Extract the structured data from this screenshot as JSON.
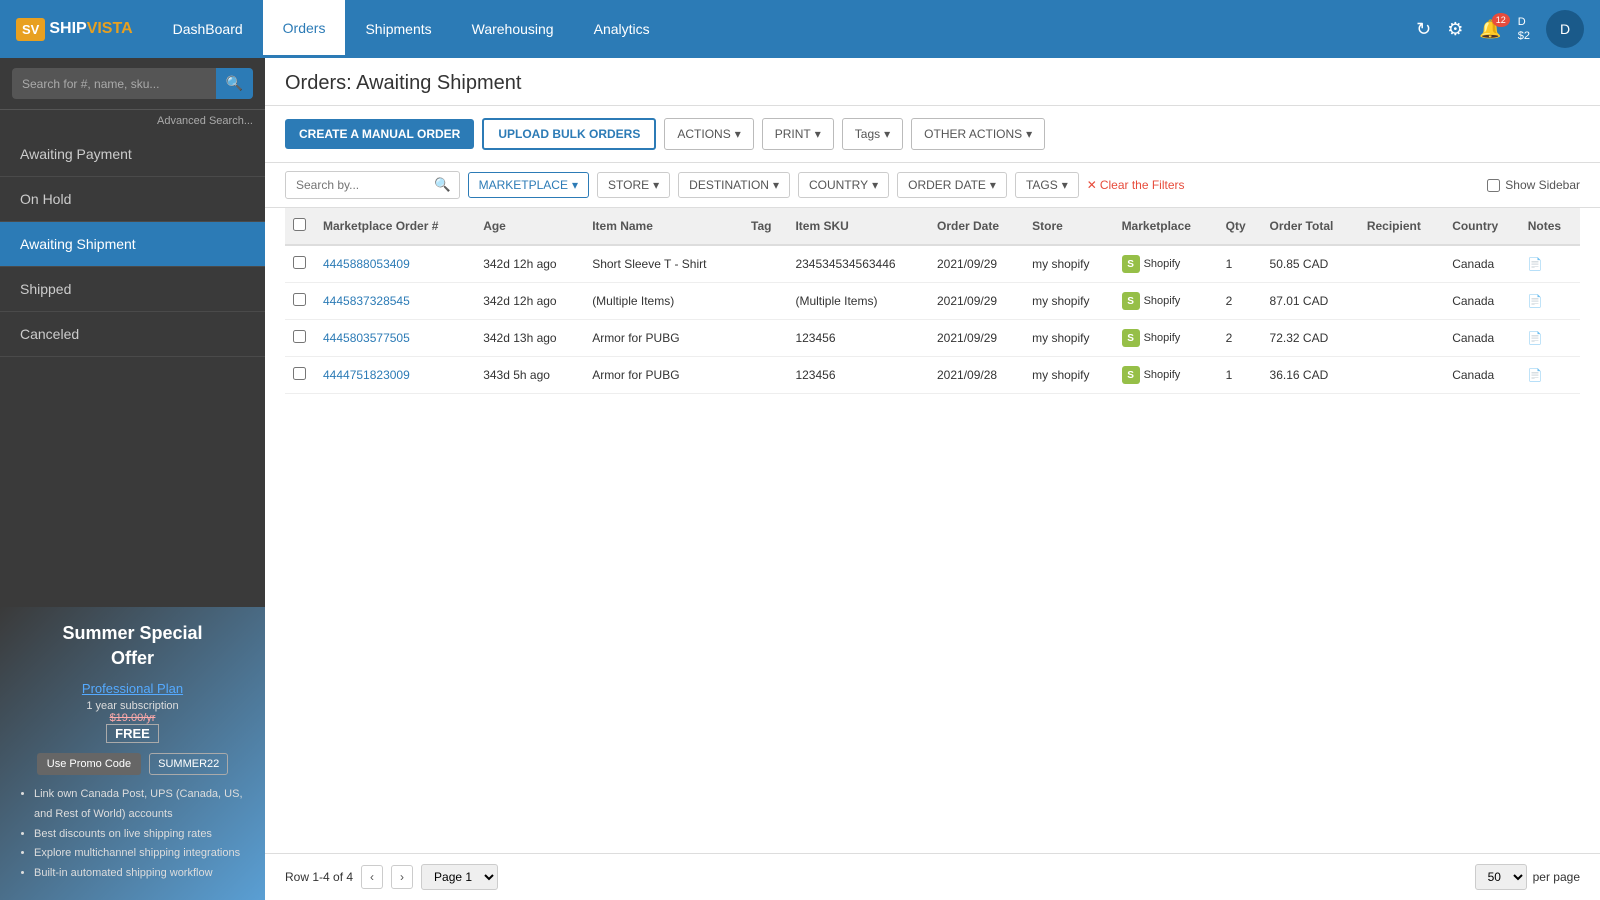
{
  "app": {
    "logo_ship": "SHIP",
    "logo_vista": "VISTA",
    "logo_icon": "SV"
  },
  "nav": {
    "items": [
      {
        "label": "DashBoard",
        "active": false
      },
      {
        "label": "Orders",
        "active": true
      },
      {
        "label": "Shipments",
        "active": false
      },
      {
        "label": "Warehousing",
        "active": false
      },
      {
        "label": "Analytics",
        "active": false
      }
    ],
    "notification_count": "12",
    "user_initials": "D",
    "user_balance": "$2"
  },
  "sidebar": {
    "search_placeholder": "Search for #, name, sku...",
    "advanced_search": "Advanced Search...",
    "nav_items": [
      {
        "label": "Awaiting Payment",
        "active": false
      },
      {
        "label": "On Hold",
        "active": false
      },
      {
        "label": "Awaiting Shipment",
        "active": true
      },
      {
        "label": "Shipped",
        "active": false
      },
      {
        "label": "Canceled",
        "active": false
      }
    ],
    "promo": {
      "title": "Summer Special",
      "subtitle": "Offer",
      "plan_name": "Professional Plan",
      "subscription": "1 year subscription",
      "old_price": "$19.00/yr",
      "price": "FREE",
      "use_promo_label": "Use Promo Code",
      "promo_code": "SUMMER22",
      "features": [
        "Link own Canada Post, UPS (Canada, US, and Rest of World) accounts",
        "Best discounts on live shipping rates",
        "Explore multichannel shipping integrations",
        "Built-in automated shipping workflow"
      ]
    }
  },
  "main": {
    "page_title": "Orders: Awaiting Shipment",
    "toolbar": {
      "create_manual": "CREATE A MANUAL ORDER",
      "upload_bulk": "UPLOAD BULK ORDERS",
      "actions": "ACTIONS",
      "print": "PRINT",
      "tags": "Tags",
      "other_actions": "OTHER ACTIONS"
    },
    "filters": {
      "search_placeholder": "Search by...",
      "marketplace_label": "MARKETPLACE",
      "store_label": "STORE",
      "destination_label": "DESTINATION",
      "country_label": "COUNTRY",
      "order_date_label": "ORDER DATE",
      "tags_label": "TAGS",
      "clear_filters": "Clear the Filters",
      "show_sidebar": "Show Sidebar"
    },
    "table": {
      "columns": [
        "Marketplace Order #",
        "Age",
        "Item Name",
        "Tag",
        "Item SKU",
        "Order Date",
        "Store",
        "Marketplace",
        "Qty",
        "Order Total",
        "Recipient",
        "Country",
        "Notes"
      ],
      "rows": [
        {
          "order_num": "4445888053409",
          "age": "342d 12h ago",
          "item_name": "Short Sleeve T - Shirt",
          "tag": "",
          "sku": "234534534563446",
          "order_date": "2021/09/29",
          "store": "my shopify",
          "marketplace": "Shopify",
          "qty": "1",
          "total": "50.85 CAD",
          "recipient": "",
          "country": "Canada",
          "notes": "📄"
        },
        {
          "order_num": "4445837328545",
          "age": "342d 12h ago",
          "item_name": "(Multiple Items)",
          "tag": "",
          "sku": "(Multiple Items)",
          "order_date": "2021/09/29",
          "store": "my shopify",
          "marketplace": "Shopify",
          "qty": "2",
          "total": "87.01 CAD",
          "recipient": "",
          "country": "Canada",
          "notes": "📄"
        },
        {
          "order_num": "4445803577505",
          "age": "342d 13h ago",
          "item_name": "Armor for PUBG",
          "tag": "",
          "sku": "123456",
          "order_date": "2021/09/29",
          "store": "my shopify",
          "marketplace": "Shopify",
          "qty": "2",
          "total": "72.32 CAD",
          "recipient": "",
          "country": "Canada",
          "notes": "📄"
        },
        {
          "order_num": "4444751823009",
          "age": "343d 5h ago",
          "item_name": "Armor for PUBG",
          "tag": "",
          "sku": "123456",
          "order_date": "2021/09/28",
          "store": "my shopify",
          "marketplace": "Shopify",
          "qty": "1",
          "total": "36.16 CAD",
          "recipient": "",
          "country": "Canada",
          "notes": "📄"
        }
      ]
    },
    "pagination": {
      "row_info": "Row 1-4 of 4",
      "page_options": [
        "Page 1"
      ],
      "per_page_options": [
        "50"
      ],
      "per_page_label": "per page"
    }
  }
}
